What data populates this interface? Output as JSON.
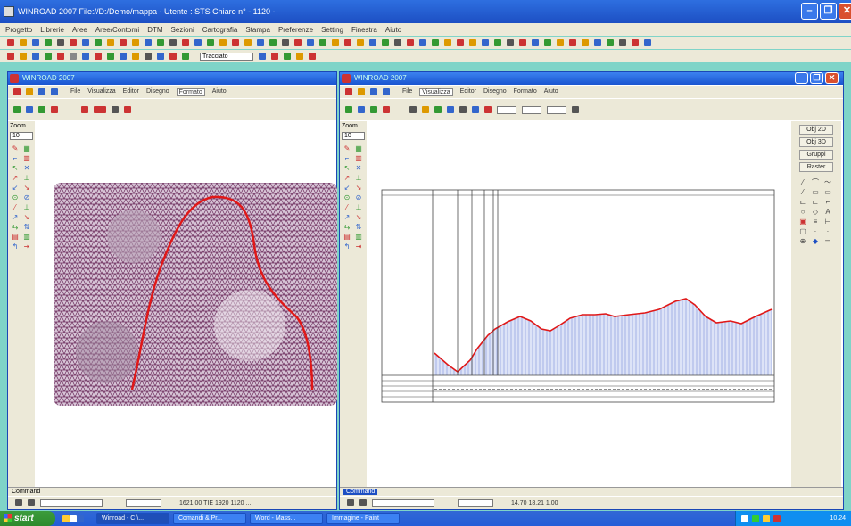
{
  "app": {
    "title": "WINROAD 2007 File://D:/Demo/mappa - Utente : STS Chiaro n° - 1120 -"
  },
  "menu": [
    "Progetto",
    "Librerie",
    "Aree",
    "Aree/Contorni",
    "DTM",
    "Sezioni",
    "Cartografia",
    "Stampa",
    "Preferenze",
    "Setting",
    "Finestra",
    "Aiuto"
  ],
  "toolbar": {
    "dropdown_value": "Tracciato"
  },
  "left_window": {
    "title": "WINROAD 2007",
    "tabs": [
      "File",
      "Visualizza",
      "Editor",
      "Disegno",
      "Formato",
      "Aiuto"
    ],
    "selected_tab": "Formato",
    "zoom_label": "Zoom",
    "zoom_value": "10",
    "command_label": "Command",
    "coord_readout": "1621.00 TIE   1920 1120   ..."
  },
  "right_window": {
    "title": "WINROAD 2007",
    "tabs": [
      "File",
      "Visualizza",
      "Editor",
      "Disegno",
      "Formato",
      "Aiuto"
    ],
    "selected_tab": "Visualizza",
    "zoom_label": "Zoom",
    "zoom_value": "10",
    "command_label": "Command",
    "coord_readout": "14.70  18.21  1.00",
    "panel_buttons": [
      "Obj 2D",
      "Obj 3D",
      "Gruppi",
      "Raster"
    ]
  },
  "taskbar": {
    "start_label": "start",
    "tasks": [
      "Winroad - C:\\...",
      "Comandi & Pr...",
      "Word - Mass...",
      "Immagine - Paint"
    ],
    "clock": "10.24"
  },
  "colors": {
    "titlebar": "#1d4fc3",
    "accent_red": "#e01818",
    "profile_fill": "#c8d2f2",
    "desktop": "#7fd4c8"
  }
}
